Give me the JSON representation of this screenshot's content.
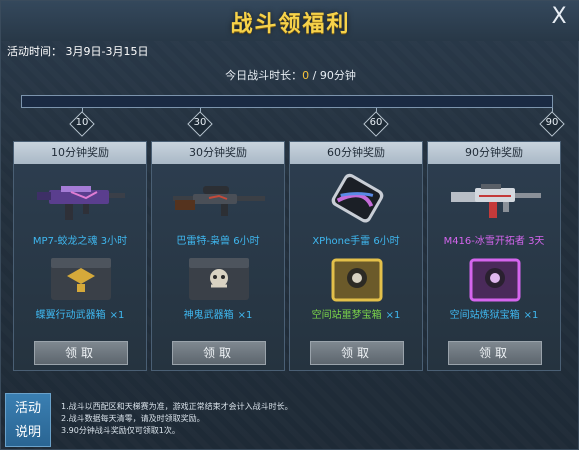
{
  "title": "战斗领福利",
  "close_label": "X",
  "event_time": "活动时间： 3月9日-3月15日",
  "progress": {
    "label_prefix": "今日战斗时长：",
    "current": "0",
    "total_suffix": " / 90分钟",
    "fraction": 0
  },
  "milestones": [
    "10",
    "30",
    "60",
    "90"
  ],
  "cards": [
    {
      "header": "10分钟奖励",
      "item_name": "MP7-蛟龙之魂 3小时",
      "box_name": "蝶翼行动武器箱",
      "box_qty": "×1",
      "claim": "领取"
    },
    {
      "header": "30分钟奖励",
      "item_name": "巴雷特-枭兽 6小时",
      "box_name": "神鬼武器箱",
      "box_qty": "×1",
      "claim": "领取"
    },
    {
      "header": "60分钟奖励",
      "item_name": "XPhone手雷 6小时",
      "box_name": "空间站噩梦宝箱",
      "box_qty": "×1",
      "claim": "领取"
    },
    {
      "header": "90分钟奖励",
      "item_name": "M416-冰雪开拓者 3天",
      "box_name": "空间站炼狱宝箱",
      "box_qty": "×1",
      "claim": "领取"
    }
  ],
  "rules_box": {
    "line1": "活动",
    "line2": "说明"
  },
  "rules": [
    "1.战斗以西配区和天梯赛为准，游戏正常结束才会计入战斗时长。",
    "2.战斗数据每天清零，请及时领取奖励。",
    "3.90分钟战斗奖励仅可领取1次。"
  ],
  "colors": {
    "title": "#f6d24a",
    "item_blue": "#3fb8f0",
    "item_purple": "#d565ee",
    "box_green": "#7bd54a",
    "progress_accent": "#f6c23a"
  }
}
